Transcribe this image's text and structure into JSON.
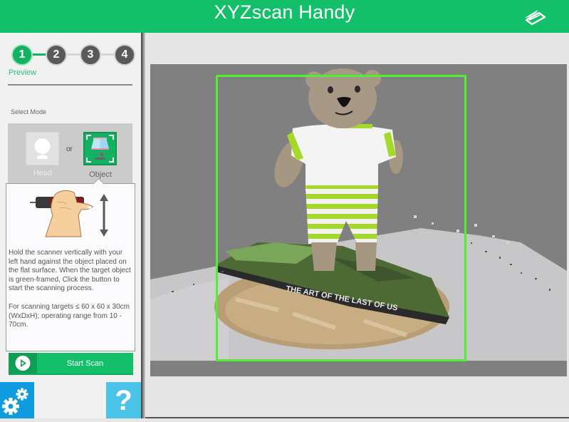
{
  "app": {
    "title": "XYZscan Handy",
    "brand_color": "#14bf69",
    "logo_icon": "xyz-layers-logo-icon"
  },
  "stepper": {
    "steps": [
      {
        "number": "1",
        "state": "active"
      },
      {
        "number": "2",
        "state": "inactive"
      },
      {
        "number": "3",
        "state": "inactive"
      },
      {
        "number": "4",
        "state": "inactive"
      }
    ],
    "current_caption": "Preview",
    "active_color": "#12b262",
    "inactive_color": "#595959"
  },
  "mode_select": {
    "label": "Select Mode",
    "separator": "or",
    "options": [
      {
        "label": "Head",
        "icon": "head-bust-icon",
        "selected": false
      },
      {
        "label": "Object",
        "icon": "lamp-object-icon",
        "selected": true
      }
    ]
  },
  "instructions": {
    "illustration": "hand-holding-scanner-vertical-arrow-icon",
    "paragraph1": "Hold the scanner vertically with your left hand against the object placed on the flat surface. When the target object is green-framed, Click the button to start the scanning process.",
    "paragraph2": "For scanning targets ≤ 60 x 60 x 30cm (WxDxH); operating range from 10 - 70cm."
  },
  "actions": {
    "start_scan_label": "Start Scan",
    "start_scan_icon": "play-circle-icon",
    "settings_icon": "gears-icon",
    "help_label": "?",
    "help_icon": "question-mark-icon"
  },
  "preview": {
    "frame_color": "#4ef030",
    "scene": "teddy bear on book on wooden turntable",
    "book_spine_text": "THE ART OF THE LAST OF US"
  }
}
